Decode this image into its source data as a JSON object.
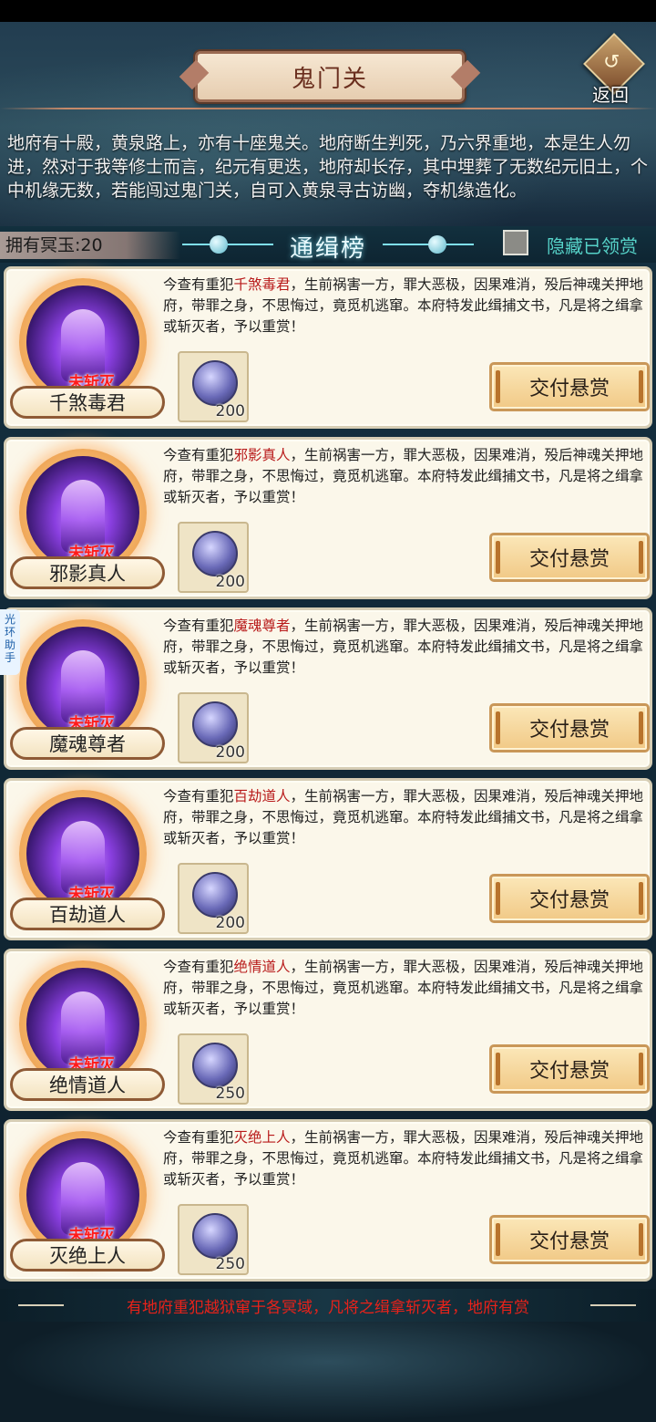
{
  "header": {
    "title": "鬼门关",
    "back_label": "返回",
    "back_glyph": "↺"
  },
  "description": "地府有十殿，黄泉路上，亦有十座鬼关。地府断生判死，乃六界重地，本是生人勿进，然对于我等修士而言，纪元有更迭，地府却长存，其中埋葬了无数纪元旧土，个中机缘无数，若能闯过鬼门关，自可入黄泉寻古访幽，夺机缘造化。",
  "list_header": {
    "currency": "拥有冥玉:20",
    "title": "通缉榜",
    "hide_claimed_label": "隐藏已领赏"
  },
  "side_tab": "光环助手",
  "cards": [
    {
      "name": "千煞毒君",
      "status": "未斩灭",
      "text_prefix": "今查有重犯",
      "text_suffix": "，生前祸害一方，罪大恶极，因果难消，殁后神魂关押地府，带罪之身，不思悔过，竟觅机逃窜。本府特发此缉捕文书，凡是将之缉拿或斩灭者，予以重赏！",
      "reward": "200",
      "button": "交付悬赏"
    },
    {
      "name": "邪影真人",
      "status": "未斩灭",
      "text_prefix": "今查有重犯",
      "text_suffix": "，生前祸害一方，罪大恶极，因果难消，殁后神魂关押地府，带罪之身，不思悔过，竟觅机逃窜。本府特发此缉捕文书，凡是将之缉拿或斩灭者，予以重赏！",
      "reward": "200",
      "button": "交付悬赏"
    },
    {
      "name": "魔魂尊者",
      "status": "未斩灭",
      "text_prefix": "今查有重犯",
      "text_suffix": "，生前祸害一方，罪大恶极，因果难消，殁后神魂关押地府，带罪之身，不思悔过，竟觅机逃窜。本府特发此缉捕文书，凡是将之缉拿或斩灭者，予以重赏！",
      "reward": "200",
      "button": "交付悬赏"
    },
    {
      "name": "百劫道人",
      "status": "未斩灭",
      "text_prefix": "今查有重犯",
      "text_suffix": "，生前祸害一方，罪大恶极，因果难消，殁后神魂关押地府，带罪之身，不思悔过，竟觅机逃窜。本府特发此缉捕文书，凡是将之缉拿或斩灭者，予以重赏！",
      "reward": "200",
      "button": "交付悬赏"
    },
    {
      "name": "绝情道人",
      "status": "未斩灭",
      "text_prefix": "今查有重犯",
      "text_suffix": "，生前祸害一方，罪大恶极，因果难消，殁后神魂关押地府，带罪之身，不思悔过，竟觅机逃窜。本府特发此缉捕文书，凡是将之缉拿或斩灭者，予以重赏！",
      "reward": "250",
      "button": "交付悬赏"
    },
    {
      "name": "灭绝上人",
      "status": "未斩灭",
      "text_prefix": "今查有重犯",
      "text_suffix": "，生前祸害一方，罪大恶极，因果难消，殁后神魂关押地府，带罪之身，不思悔过，竟觅机逃窜。本府特发此缉捕文书，凡是将之缉拿或斩灭者，予以重赏！",
      "reward": "250",
      "button": "交付悬赏"
    }
  ],
  "footer": "有地府重犯越狱窜于各冥域，凡将之缉拿斩灭者，地府有赏",
  "colors": {
    "accent_red": "#b81a1a",
    "footer_red": "#e8221a",
    "hide_label_teal": "#56d2c8",
    "card_bg": "#fbf7ea"
  }
}
